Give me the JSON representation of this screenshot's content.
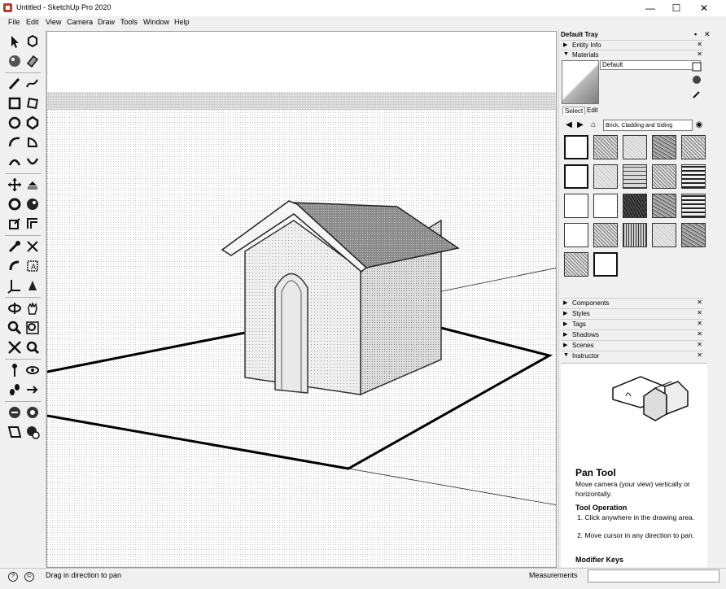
{
  "window": {
    "title": "Untitled - SketchUp Pro 2020",
    "minimize": "—",
    "maximize": "☐",
    "close": "✕"
  },
  "menu": [
    "File",
    "Edit",
    "View",
    "Camera",
    "Draw",
    "Tools",
    "Window",
    "Help"
  ],
  "toolbar": {
    "tools": [
      "select-tool",
      "make-component-tool",
      "paint-bucket-tool",
      "eraser-tool",
      "line-tool",
      "freehand-tool",
      "rectangle-tool",
      "rotated-rectangle-tool",
      "circle-tool",
      "polygon-tool",
      "arc-tool",
      "pie-tool",
      "three-point-arc-tool",
      "two-point-arc-tool",
      "move-tool",
      "push-pull-tool",
      "rotate-tool",
      "follow-me-tool",
      "scale-tool",
      "offset-tool",
      "tape-measure-tool",
      "dimension-tool",
      "protractor-tool",
      "text-tool",
      "axes-tool",
      "3d-text-tool",
      "orbit-tool",
      "pan-tool",
      "zoom-tool",
      "zoom-window-tool",
      "zoom-extents-tool",
      "previous-view-tool",
      "position-camera-tool",
      "look-around-tool",
      "walk-tool",
      "section-plane-tool",
      "3d-warehouse-tool",
      "extension-warehouse-tool",
      "layout-tool",
      "extension-manager-tool"
    ]
  },
  "tray": {
    "title": "Default Tray",
    "panels_top": [
      {
        "label": "Entity Info",
        "collapsed": true
      },
      {
        "label": "Materials",
        "collapsed": false
      }
    ],
    "materials": {
      "name": "Default",
      "tabs": [
        "Select",
        "Edit"
      ],
      "active_tab": "Select",
      "library": "Brick, Cladding and Siding",
      "home_icon": "home-icon"
    },
    "panels_bottom": [
      {
        "label": "Components"
      },
      {
        "label": "Styles"
      },
      {
        "label": "Tags"
      },
      {
        "label": "Shadows"
      },
      {
        "label": "Scenes"
      },
      {
        "label": "Instructor"
      }
    ],
    "instructor": {
      "title": "Pan Tool",
      "description": "Move camera (your view) vertically or horizontally.",
      "operation_title": "Tool Operation",
      "steps": [
        "1. Click anywhere in the drawing area.",
        "2. Move cursor in any direction to pan."
      ],
      "modifier_title": "Modifier Keys"
    }
  },
  "status": {
    "message": "Drag in direction to pan",
    "measurements_label": "Measurements",
    "measurements_value": ""
  },
  "colors": {
    "background": "#f0f0f0",
    "viewport": "#ffffff",
    "line": "#000000"
  }
}
